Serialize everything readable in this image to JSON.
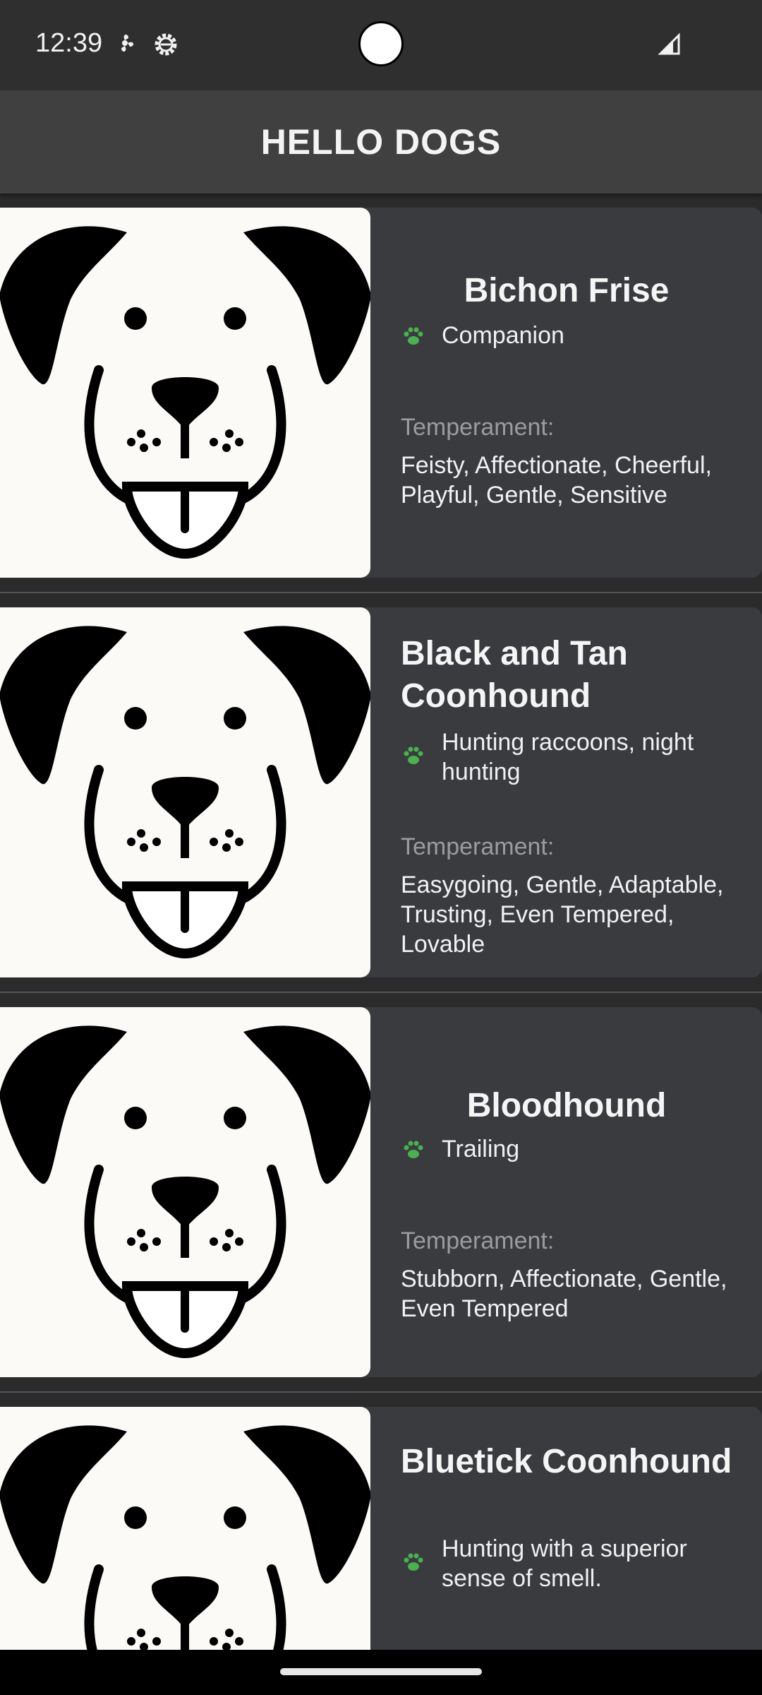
{
  "status_bar": {
    "time": "12:39",
    "icons": [
      "fan-icon",
      "settings-icon",
      "signal-icon"
    ]
  },
  "app_bar": {
    "title": "HELLO DOGS"
  },
  "temperament_label": "Temperament:",
  "colors": {
    "paw": "#4caf50",
    "card_bg": "#3a3b3f",
    "app_bar_bg": "#404040"
  },
  "dogs": [
    {
      "name": "Bichon Frise",
      "bred_for": "Companion",
      "temperament": "Feisty, Affectionate, Cheerful, Playful, Gentle, Sensitive"
    },
    {
      "name": "Black and Tan Coonhound",
      "bred_for": "Hunting raccoons, night hunting",
      "temperament": "Easygoing, Gentle, Adaptable, Trusting, Even Tempered, Lovable"
    },
    {
      "name": "Bloodhound",
      "bred_for": "Trailing",
      "temperament": "Stubborn, Affectionate, Gentle, Even Tempered"
    },
    {
      "name": "Bluetick Coonhound",
      "bred_for": "Hunting with a superior sense of smell.",
      "temperament": ""
    }
  ]
}
